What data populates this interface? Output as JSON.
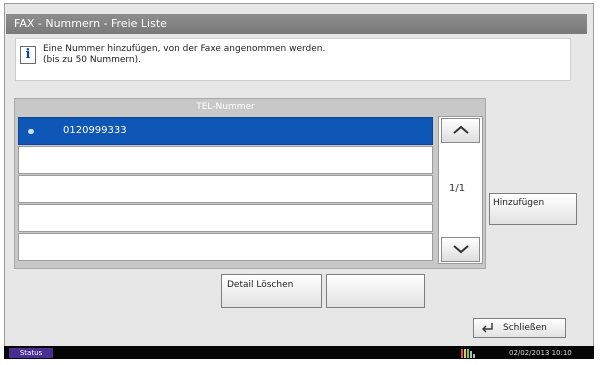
{
  "window": {
    "title": "FAX - Nummern - Freie Liste"
  },
  "info": {
    "line1": "Eine Nummer hinzufügen, von der Faxe angenommen werden.",
    "line2": "(bis zu 50 Nummern)."
  },
  "list": {
    "header": "TEL-Nummer",
    "rows": [
      "0120999333",
      "",
      "",
      "",
      ""
    ],
    "selected_index": 0,
    "page_indicator": "1/1"
  },
  "buttons": {
    "add": "Hinzufügen",
    "detail_delete": "Detail Löschen",
    "blank": "",
    "close": "Schließen"
  },
  "status_bar": {
    "status_label": "Status",
    "datetime": "02/02/2013  10:10"
  },
  "icons": {
    "info": "info-icon",
    "scroll_up": "chevron-up-icon",
    "scroll_down": "chevron-down-icon",
    "close": "return-arrow-icon",
    "signal": "signal-bars-icon"
  },
  "colors": {
    "title_bar": "#8e8e8e",
    "selection": "#0f57b6",
    "status_button": "#4a2f92",
    "status_bar": "#050505"
  }
}
